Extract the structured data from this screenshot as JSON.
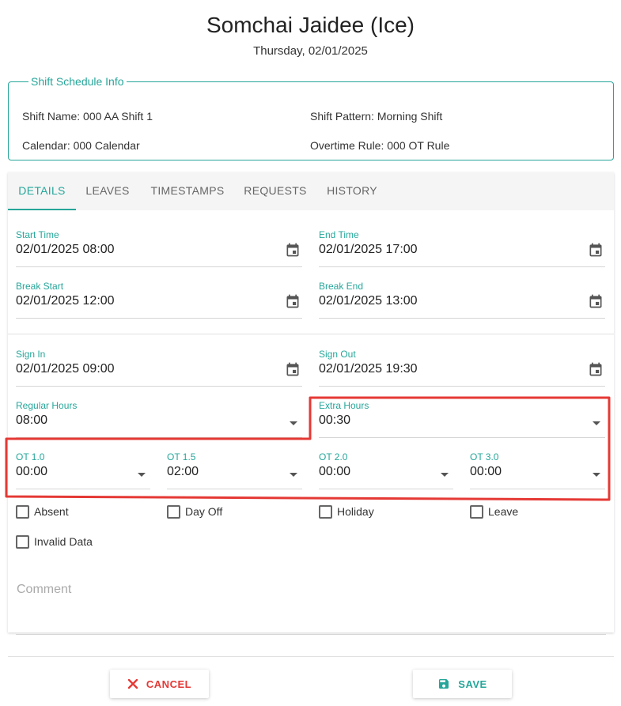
{
  "header": {
    "name": "Somchai Jaidee (Ice)",
    "date": "Thursday, 02/01/2025"
  },
  "shift_info": {
    "legend": "Shift Schedule Info",
    "shift_name": "Shift Name:  000 AA Shift 1",
    "calendar": "Calendar:  000 Calendar",
    "shift_pattern": "Shift Pattern:  Morning Shift",
    "overtime_rule": "Overtime Rule:  000 OT Rule"
  },
  "tabs": [
    "DETAILS",
    "LEAVES",
    "TIMESTAMPS",
    "REQUESTS",
    "HISTORY"
  ],
  "fields": {
    "start_time": {
      "label": "Start Time",
      "value": "02/01/2025 08:00"
    },
    "end_time": {
      "label": "End Time",
      "value": "02/01/2025 17:00"
    },
    "break_start": {
      "label": "Break Start",
      "value": "02/01/2025 12:00"
    },
    "break_end": {
      "label": "Break End",
      "value": "02/01/2025 13:00"
    },
    "sign_in": {
      "label": "Sign In",
      "value": "02/01/2025 09:00"
    },
    "sign_out": {
      "label": "Sign Out",
      "value": "02/01/2025 19:30"
    },
    "regular_hours": {
      "label": "Regular Hours",
      "value": "08:00"
    },
    "extra_hours": {
      "label": "Extra Hours",
      "value": "00:30"
    },
    "ot_1_0": {
      "label": "OT 1.0",
      "value": "00:00"
    },
    "ot_1_5": {
      "label": "OT 1.5",
      "value": "02:00"
    },
    "ot_2_0": {
      "label": "OT 2.0",
      "value": "00:00"
    },
    "ot_3_0": {
      "label": "OT 3.0",
      "value": "00:00"
    }
  },
  "checkboxes": {
    "absent": "Absent",
    "day_off": "Day Off",
    "holiday": "Holiday",
    "leave": "Leave",
    "invalid_data": "Invalid Data"
  },
  "comment": {
    "placeholder": "Comment"
  },
  "buttons": {
    "cancel": "CANCEL",
    "save": "SAVE"
  },
  "colors": {
    "accent": "#26a69a",
    "cancel": "#e53935",
    "highlight": "#e53935"
  }
}
